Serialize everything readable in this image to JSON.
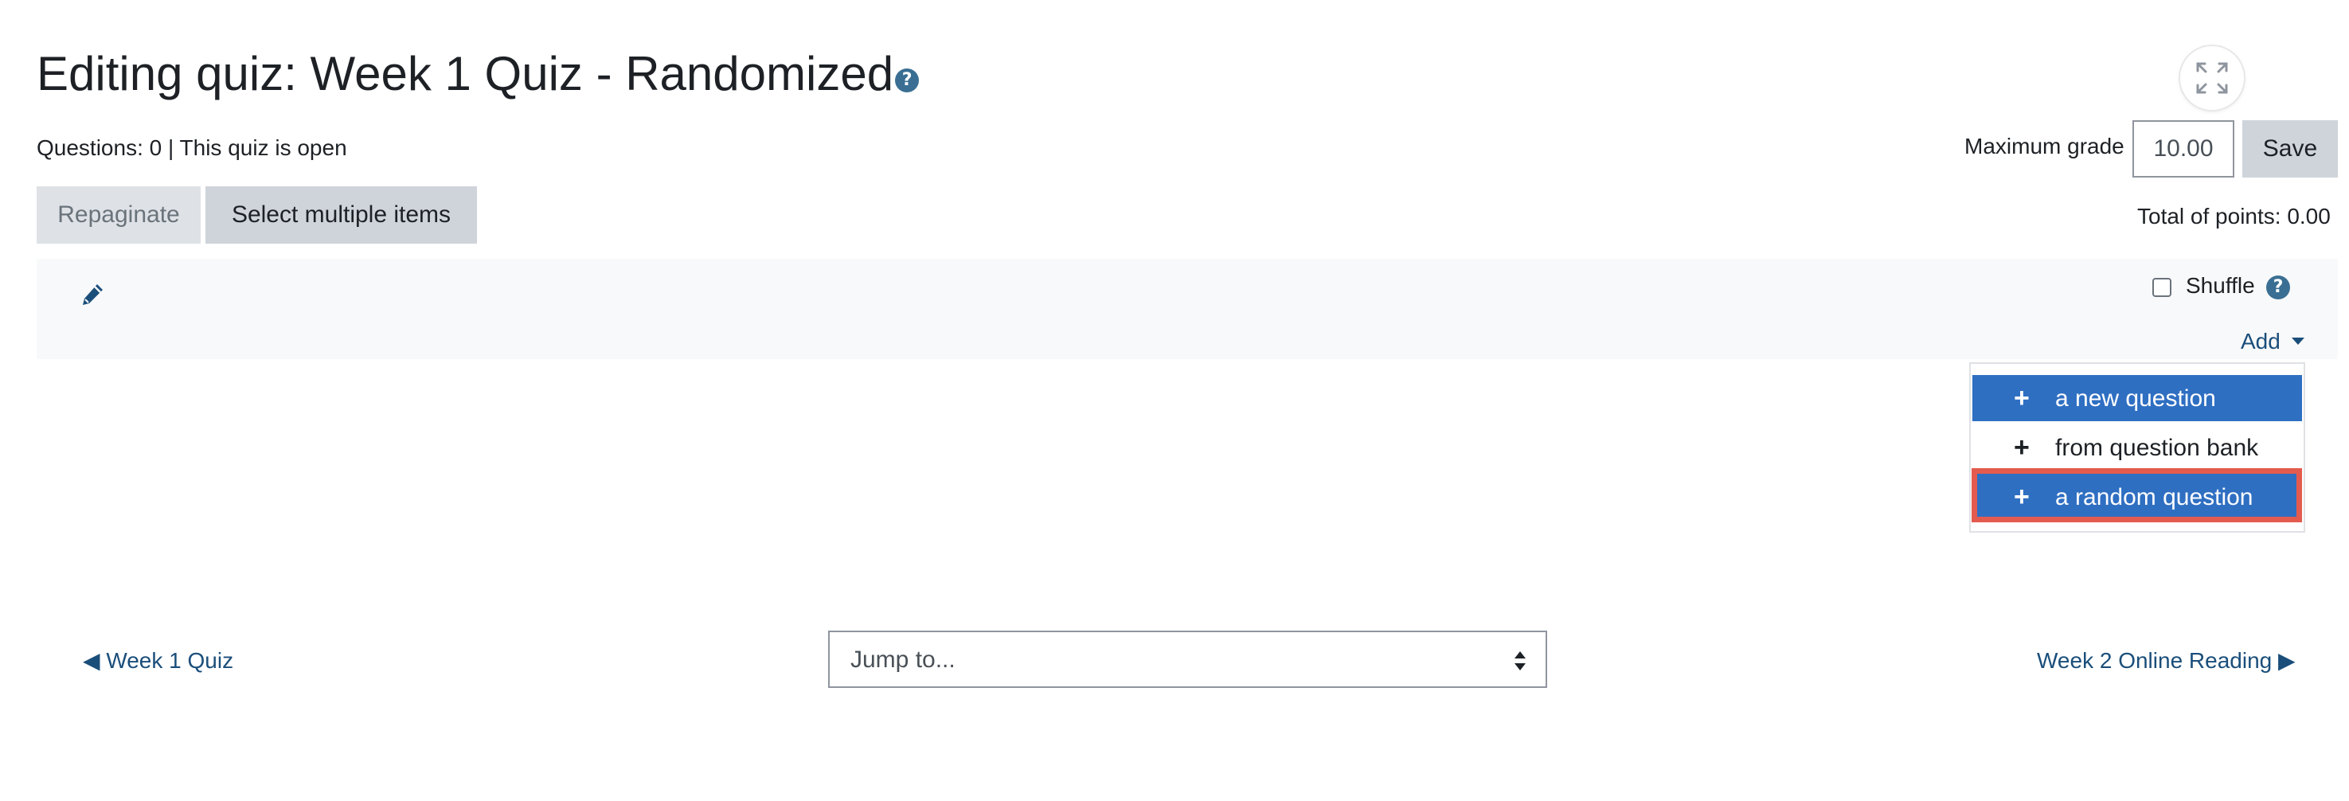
{
  "header": {
    "title": "Editing quiz: Week 1 Quiz - Randomized",
    "help_icon": "question-circle-icon",
    "expand_icon": "fullscreen-expand-icon"
  },
  "status_line": "Questions: 0 | This quiz is open",
  "grade": {
    "label": "Maximum grade",
    "value": "10.00",
    "save_label": "Save"
  },
  "toolbar": {
    "repaginate_label": "Repaginate",
    "select_multiple_label": "Select multiple items"
  },
  "total_points": "Total of points: 0.00",
  "section": {
    "edit_icon": "pencil-icon",
    "shuffle_label": "Shuffle",
    "shuffle_checked": false,
    "add_label": "Add"
  },
  "add_menu": {
    "items": [
      {
        "label": "a new question",
        "icon": "plus-icon",
        "highlighted": true
      },
      {
        "label": "from question bank",
        "icon": "plus-icon",
        "highlighted": false
      },
      {
        "label": "a random question",
        "icon": "plus-icon",
        "highlighted": true
      }
    ]
  },
  "nav": {
    "prev_label": "◀ Week 1 Quiz",
    "next_label": "Week 2 Online Reading ▶",
    "jump_placeholder": "Jump to..."
  },
  "colors": {
    "menu_highlight": "#2f6fc2",
    "annotation_ring": "#e35b4e",
    "link": "#1a4e7a",
    "help_icon": "#3a6f93"
  }
}
